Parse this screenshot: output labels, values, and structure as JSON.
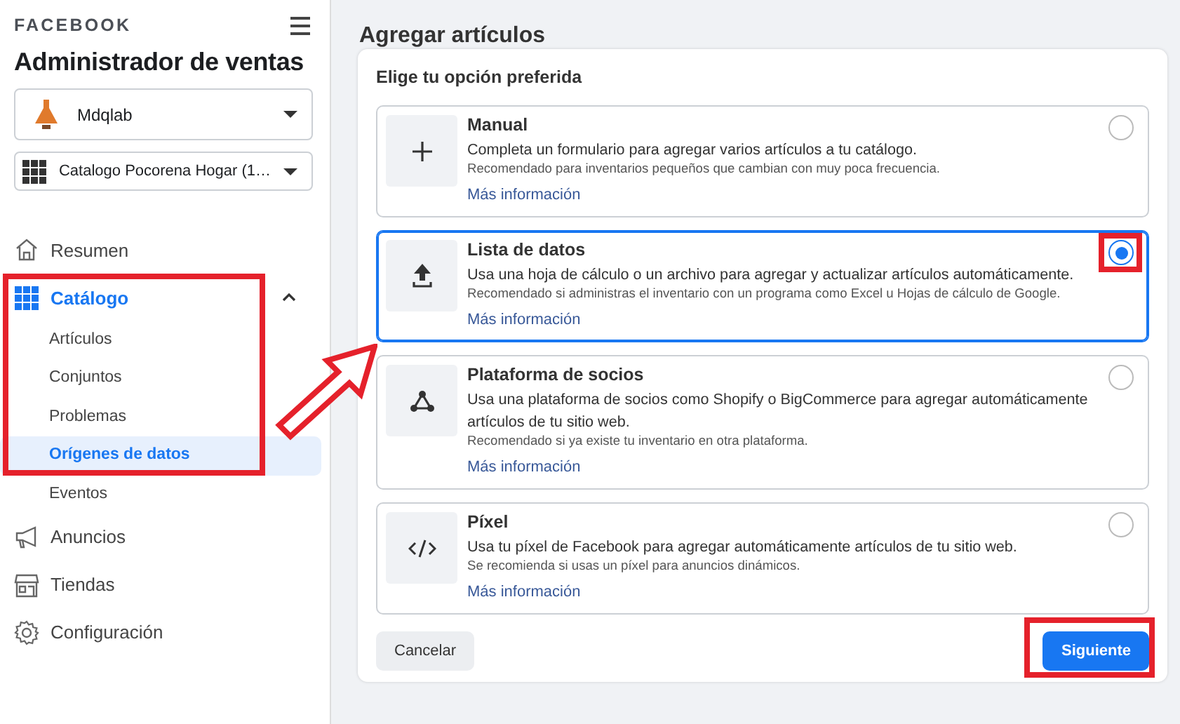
{
  "sidebar": {
    "brand": "FACEBOOK",
    "app_title": "Administrador de ventas",
    "account_select": {
      "value": "Mdqlab"
    },
    "catalog_select": {
      "value": "Catalogo Pocorena Hogar (1…"
    },
    "nav": [
      {
        "label": "Resumen",
        "selected": false
      },
      {
        "label": "Catálogo",
        "selected": true,
        "expanded": true,
        "highlighted": true,
        "pointer_arrow": true,
        "children": [
          {
            "label": "Artículos",
            "selected": false
          },
          {
            "label": "Conjuntos",
            "selected": false
          },
          {
            "label": "Problemas",
            "selected": false
          },
          {
            "label": "Orígenes de datos",
            "selected": true
          },
          {
            "label": "Eventos",
            "selected": false
          }
        ]
      },
      {
        "label": "Anuncios",
        "selected": false
      },
      {
        "label": "Tiendas",
        "selected": false
      },
      {
        "label": "Configuración",
        "selected": false
      }
    ]
  },
  "main": {
    "page_title": "Agregar artículos",
    "card": {
      "heading": "Elige tu opción preferida",
      "options": [
        {
          "title": "Manual",
          "description": "Completa un formulario para agregar varios artículos a tu catálogo.",
          "note": "Recomendado para inventarios pequeños que cambian con muy poca frecuencia.",
          "link": "Más información",
          "selected": false,
          "highlighted": false
        },
        {
          "title": "Lista de datos",
          "description": "Usa una hoja de cálculo o un archivo para agregar y actualizar artículos automáticamente.",
          "note": "Recomendado si administras el inventario con un programa como Excel u Hojas de cálculo de Google.",
          "link": "Más información",
          "selected": true,
          "highlighted": true
        },
        {
          "title": "Plataforma de socios",
          "description": "Usa una plataforma de socios como Shopify o BigCommerce para agregar automáticamente artículos de tu sitio web.",
          "note": "Recomendado si ya existe tu inventario en otra plataforma.",
          "link": "Más información",
          "selected": false,
          "highlighted": false
        },
        {
          "title": "Píxel",
          "description": "Usa tu píxel de Facebook para agregar automáticamente artículos de tu sitio web.",
          "note": "Se recomienda si usas un píxel para anuncios dinámicos.",
          "link": "Más información",
          "selected": false,
          "highlighted": false
        }
      ],
      "cancel_button": {
        "label": "Cancelar"
      },
      "next_button": {
        "label": "Siguiente",
        "highlighted": true
      }
    }
  }
}
